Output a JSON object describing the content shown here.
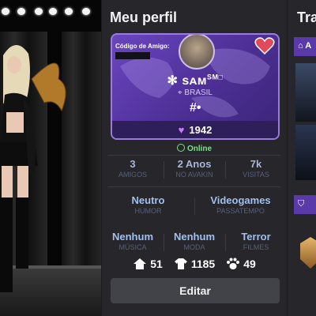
{
  "profile": {
    "title": "Meu perfil",
    "friend_code_label": "Código de Amigo:",
    "username": "✻ sᴀᴍ",
    "username_sup": "SM□",
    "country": "BRASIL",
    "hashtag": "#•",
    "score": "1942",
    "status": "Online"
  },
  "stats_row1": [
    {
      "value": "3",
      "label": "AMIGOS"
    },
    {
      "value": "2 Anos",
      "label": "NO AVAKIN"
    },
    {
      "value": "7k",
      "label": "VISITAS"
    }
  ],
  "stats_row2": [
    {
      "value": "Neutro",
      "label": "HUMOR"
    },
    {
      "value": "Videogames",
      "label": "PASSATEMPO"
    }
  ],
  "stats_row3": [
    {
      "value": "Nenhum",
      "label": "MÚSICA"
    },
    {
      "value": "Nenhum",
      "label": "MODA"
    },
    {
      "value": "Terror",
      "label": "FILMES"
    }
  ],
  "counts": {
    "homes": "51",
    "outfits": "1185",
    "pets": "49"
  },
  "edit_label": "Editar",
  "right_panel": {
    "title": "Tra",
    "tab": "A"
  },
  "icons": {
    "home": "home-icon",
    "shirt": "shirt-icon",
    "paw": "paw-icon",
    "heart": "heart-icon",
    "location": "location-pin-icon",
    "clock": "clock-icon"
  },
  "colors": {
    "card": "#5a3aa8",
    "online": "#7ee08a",
    "stat_value": "#a7b5d8"
  }
}
